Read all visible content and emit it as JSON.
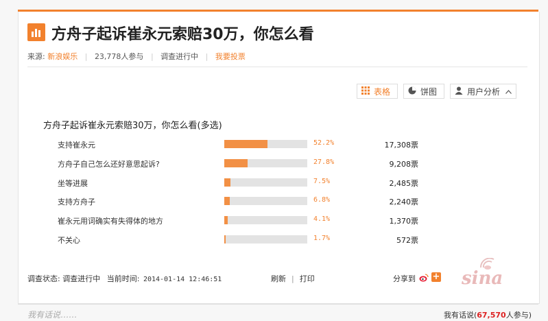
{
  "survey": {
    "title": "方舟子起诉崔永元索赔30万，你怎么看",
    "meta": {
      "source_label": "来源:",
      "source_value": "新浪娱乐",
      "participants": "23,778人参与",
      "status": "调查进行中",
      "vote_link": "我要投票"
    },
    "tabs": [
      {
        "label": "表格",
        "icon": "grid-icon"
      },
      {
        "label": "饼图",
        "icon": "pie-chart-icon"
      },
      {
        "label": "用户分析",
        "icon": "user-icon"
      }
    ],
    "question": "方舟子起诉崔永元索赔30万，你怎么看(多选)",
    "options": [
      {
        "label": "支持崔永元",
        "percent": 52.2,
        "percent_text": "52.2%",
        "votes": "17,308票"
      },
      {
        "label": "方舟子自己怎么还好意思起诉?",
        "percent": 27.8,
        "percent_text": "27.8%",
        "votes": "9,208票"
      },
      {
        "label": "坐等进展",
        "percent": 7.5,
        "percent_text": "7.5%",
        "votes": "2,485票"
      },
      {
        "label": "支持方舟子",
        "percent": 6.8,
        "percent_text": "6.8%",
        "votes": "2,240票"
      },
      {
        "label": "崔永元用词确实有失得体的地方",
        "percent": 4.1,
        "percent_text": "4.1%",
        "votes": "1,370票"
      },
      {
        "label": "不关心",
        "percent": 1.7,
        "percent_text": "1.7%",
        "votes": "572票"
      }
    ],
    "footer": {
      "status_label": "调查状态:",
      "status_value": "调查进行中",
      "time_label": "当前时间:",
      "time_value": "2014-01-14 12:46:51",
      "refresh": "刷新",
      "print": "打印",
      "share_label": "分享到"
    },
    "logo_text": "sina"
  },
  "comments": {
    "hint": "我有话说……",
    "talk_prefix": "我有话说(",
    "talk_count": "67,570",
    "talk_suffix": "人参与)"
  },
  "colors": {
    "accent": "#f2812d",
    "bar_fill": "#f29045",
    "bar_track": "#e3e3e3"
  }
}
